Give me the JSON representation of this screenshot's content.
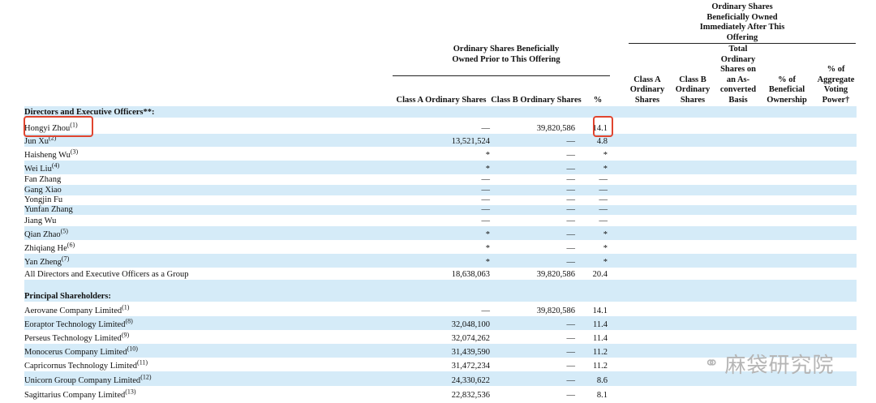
{
  "headers": {
    "prior_group": "Ordinary Shares Beneficially Owned Prior to This Offering",
    "after_group": "Ordinary Shares Beneficially Owned Immediately After This Offering",
    "prior_cols": [
      "Class A Ordinary Shares",
      "Class B Ordinary Shares",
      "%"
    ],
    "after_cols": [
      "Class A Ordinary Shares",
      "Class B Ordinary Shares",
      "Total Ordinary Shares on an As-converted Basis",
      "% of Beneficial Ownership",
      "% of Aggregate Voting Power†"
    ]
  },
  "rows": [
    {
      "name": "Directors and Executive Officers**:",
      "section": true
    },
    {
      "name": "Hongyi Zhou",
      "note": "(1)",
      "a": "—",
      "b": "39,820,586",
      "pct": "14.1",
      "highlight": true
    },
    {
      "name": "Jun Xu",
      "note": "(2)",
      "a": "13,521,524",
      "b": "—",
      "pct": "4.8"
    },
    {
      "name": "Haisheng Wu",
      "note": "(3)",
      "a": "*",
      "b": "—",
      "pct": "*"
    },
    {
      "name": "Wei Liu",
      "note": "(4)",
      "a": "*",
      "b": "—",
      "pct": "*"
    },
    {
      "name": "Fan Zhang",
      "a": "—",
      "b": "—",
      "pct": "—"
    },
    {
      "name": "Gang Xiao",
      "a": "—",
      "b": "—",
      "pct": "—"
    },
    {
      "name": "Yongjin Fu",
      "a": "—",
      "b": "—",
      "pct": "—"
    },
    {
      "name": "Yunfan Zhang",
      "a": "—",
      "b": "—",
      "pct": "—"
    },
    {
      "name": "Jiang Wu",
      "a": "—",
      "b": "—",
      "pct": "—"
    },
    {
      "name": "Qian Zhao",
      "note": "(5)",
      "a": "*",
      "b": "—",
      "pct": "*"
    },
    {
      "name": "Zhiqiang He",
      "note": "(6)",
      "a": "*",
      "b": "—",
      "pct": "*"
    },
    {
      "name": "Yan Zheng",
      "note": "(7)",
      "a": "*",
      "b": "—",
      "pct": "*"
    },
    {
      "name": "All Directors and Executive Officers as a Group",
      "a": "18,638,063",
      "b": "39,820,586",
      "pct": "20.4",
      "total": true
    },
    {
      "name": "Principal Shareholders:",
      "section": true
    },
    {
      "name": "Aerovane Company Limited",
      "note": "(1)",
      "a": "—",
      "b": "39,820,586",
      "pct": "14.1"
    },
    {
      "name": "Eoraptor Technology Limited",
      "note": "(8)",
      "a": "32,048,100",
      "b": "—",
      "pct": "11.4"
    },
    {
      "name": "Perseus Technology Limited",
      "note": "(9)",
      "a": "32,074,262",
      "b": "—",
      "pct": "11.4"
    },
    {
      "name": "Monocerus Company Limited",
      "note": "(10)",
      "a": "31,439,590",
      "b": "—",
      "pct": "11.2"
    },
    {
      "name": "Capricornus Technology Limited",
      "note": "(11)",
      "a": "31,472,234",
      "b": "—",
      "pct": "11.2"
    },
    {
      "name": "Unicorn Group Company Limited",
      "note": "(12)",
      "a": "24,330,622",
      "b": "—",
      "pct": "8.6"
    },
    {
      "name": "Sagittarius Company Limited",
      "note": "(13)",
      "a": "22,832,536",
      "b": "—",
      "pct": "8.1"
    }
  ],
  "watermark": "麻袋研究院",
  "colors": {
    "stripe": "#d5ebf8",
    "highlight": "#e0452f"
  }
}
